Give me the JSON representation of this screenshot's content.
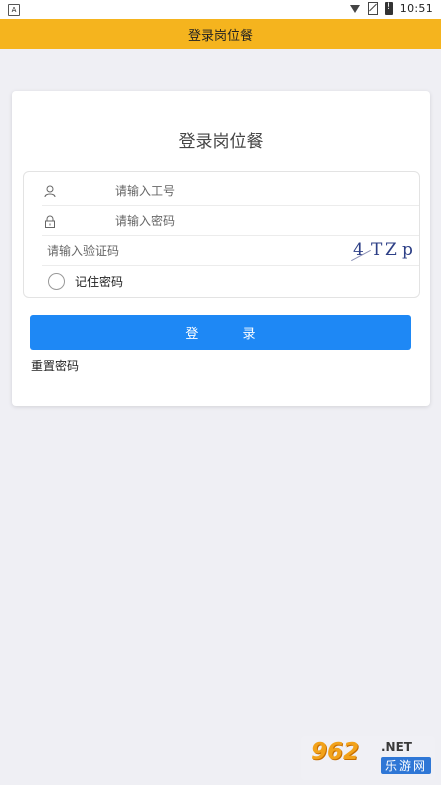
{
  "status_bar": {
    "left_icon_letter": "A",
    "time": "10:51",
    "icons": [
      "wifi-icon",
      "no-sim-icon",
      "battery-icon"
    ]
  },
  "app_bar": {
    "title": "登录岗位餐",
    "color": "#f5b41e"
  },
  "login_card": {
    "title": "登录岗位餐",
    "employee_id_placeholder": "请输入工号",
    "password_placeholder": "请输入密码",
    "captcha_placeholder": "请输入验证码",
    "captcha_chars": [
      "4",
      "T",
      "Z",
      "p"
    ],
    "remember_label": "记住密码",
    "remember_checked": false,
    "login_button_label": "登 录",
    "reset_password_label": "重置密码",
    "accent": "#1e88f5"
  },
  "watermark": {
    "logo": "962",
    "domain": ".NET",
    "name": "乐游网"
  }
}
